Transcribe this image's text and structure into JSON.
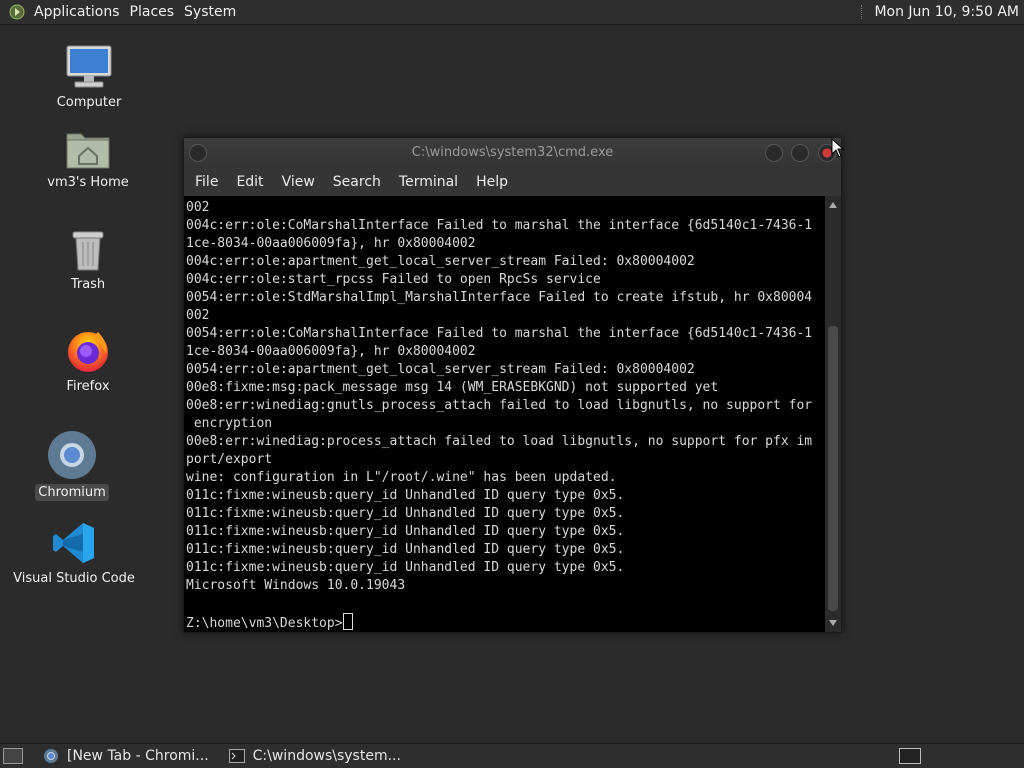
{
  "top_panel": {
    "menus": [
      "Applications",
      "Places",
      "System"
    ],
    "clock": "Mon Jun 10,  9:50 AM"
  },
  "desktop_icons": [
    {
      "label": "Computer",
      "icon": "monitor-icon"
    },
    {
      "label": "vm3's Home",
      "icon": "home-folder-icon"
    },
    {
      "label": "Trash",
      "icon": "trash-icon"
    },
    {
      "label": "Firefox",
      "icon": "firefox-icon"
    },
    {
      "label": "Chromium",
      "icon": "chromium-icon"
    },
    {
      "label": "Visual Studio Code",
      "icon": "vscode-icon"
    }
  ],
  "window": {
    "title": "C:\\windows\\system32\\cmd.exe",
    "menu": [
      "File",
      "Edit",
      "View",
      "Search",
      "Terminal",
      "Help"
    ],
    "lines": [
      "002",
      "004c:err:ole:CoMarshalInterface Failed to marshal the interface {6d5140c1-7436-1",
      "1ce-8034-00aa006009fa}, hr 0x80004002",
      "004c:err:ole:apartment_get_local_server_stream Failed: 0x80004002",
      "004c:err:ole:start_rpcss Failed to open RpcSs service",
      "0054:err:ole:StdMarshalImpl_MarshalInterface Failed to create ifstub, hr 0x80004",
      "002",
      "0054:err:ole:CoMarshalInterface Failed to marshal the interface {6d5140c1-7436-1",
      "1ce-8034-00aa006009fa}, hr 0x80004002",
      "0054:err:ole:apartment_get_local_server_stream Failed: 0x80004002",
      "00e8:fixme:msg:pack_message msg 14 (WM_ERASEBKGND) not supported yet",
      "00e8:err:winediag:gnutls_process_attach failed to load libgnutls, no support for",
      " encryption",
      "00e8:err:winediag:process_attach failed to load libgnutls, no support for pfx im",
      "port/export",
      "wine: configuration in L\"/root/.wine\" has been updated.",
      "011c:fixme:wineusb:query_id Unhandled ID query type 0x5.",
      "011c:fixme:wineusb:query_id Unhandled ID query type 0x5.",
      "011c:fixme:wineusb:query_id Unhandled ID query type 0x5.",
      "011c:fixme:wineusb:query_id Unhandled ID query type 0x5.",
      "011c:fixme:wineusb:query_id Unhandled ID query type 0x5.",
      "Microsoft Windows 10.0.19043",
      ""
    ],
    "prompt": "Z:\\home\\vm3\\Desktop>"
  },
  "taskbar": {
    "tasks": [
      {
        "label": "[New Tab - Chromi...",
        "icon": "chromium-icon"
      },
      {
        "label": "C:\\windows\\system...",
        "icon": "terminal-icon"
      }
    ]
  }
}
